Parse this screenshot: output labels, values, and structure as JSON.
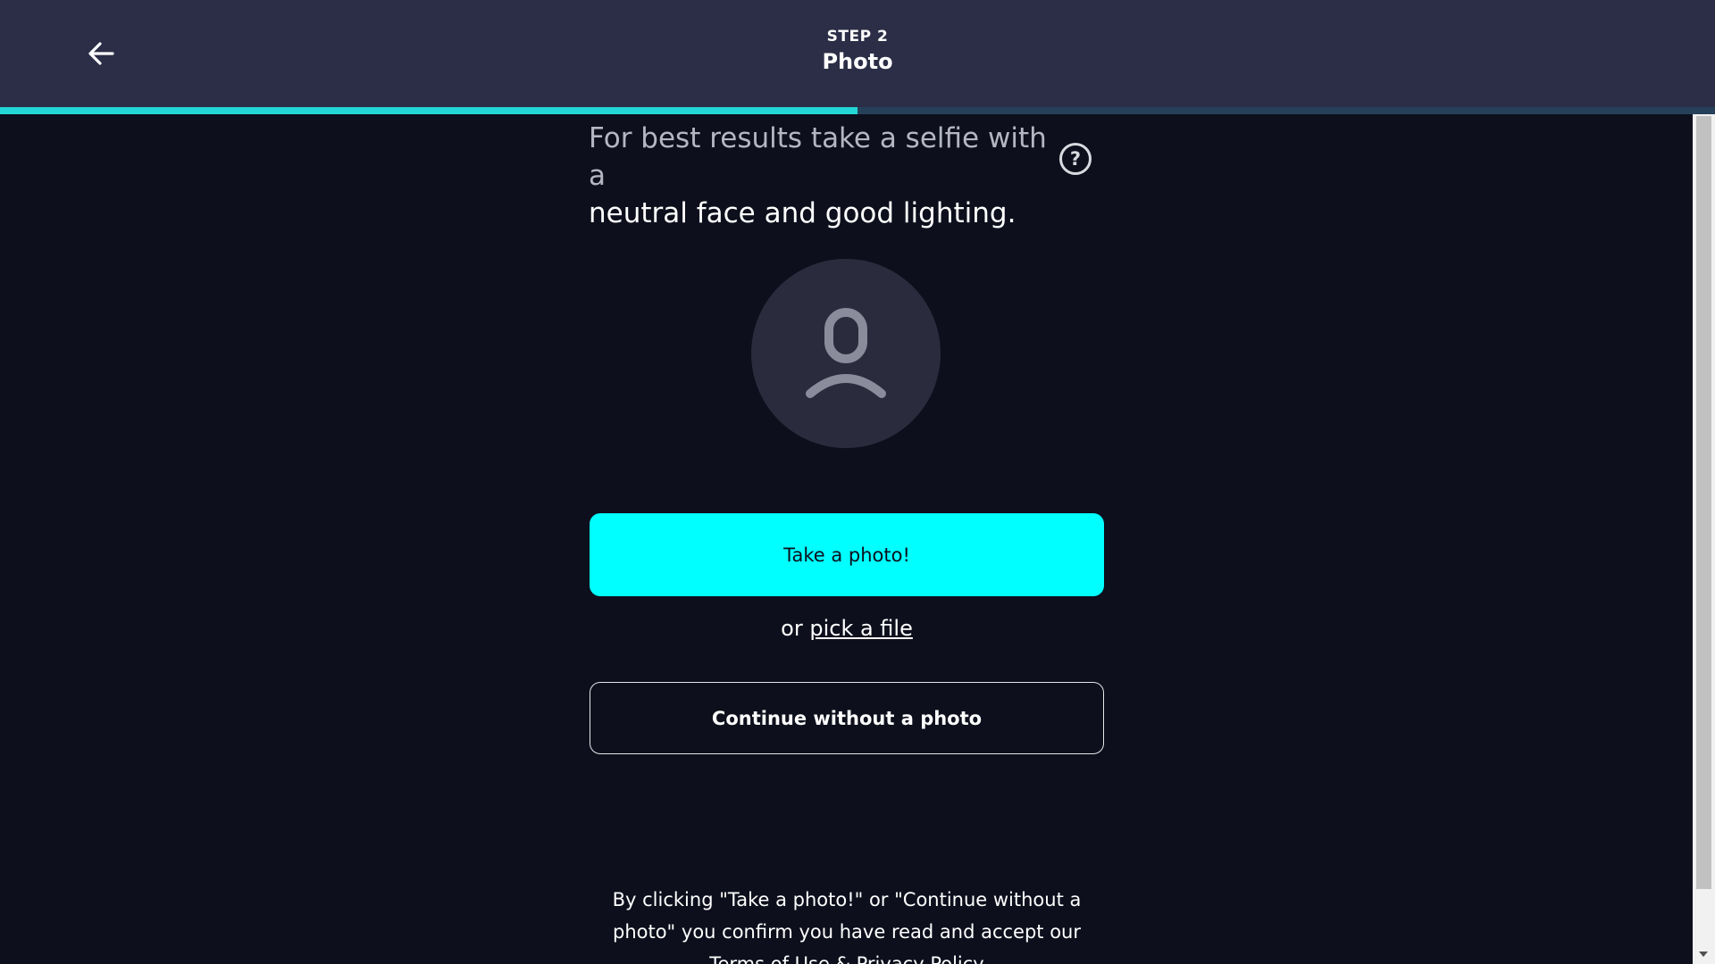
{
  "header": {
    "step_label": "STEP 2",
    "title": "Photo",
    "back_icon": "arrow-left-icon",
    "progress": 0.5
  },
  "main": {
    "instruction_muted": "For best results take a selfie with a",
    "instruction_strong": "neutral face and good lighting.",
    "help_icon": "question-circle-icon",
    "help_glyph": "?",
    "avatar_icon": "user-placeholder-icon",
    "take_photo_label": "Take a photo!",
    "pick_prefix": "or",
    "pick_link": "pick a file",
    "continue_label": "Continue without a photo"
  },
  "footer": {
    "legal_text": "By clicking \"Take a photo!\" or \"Continue without a photo\" you confirm you have read and accept our",
    "legal_link": "Terms of Use & Privacy Policy"
  },
  "colors": {
    "background": "#0d0f1c",
    "header": "#2b2e46",
    "accent": "#00ffff",
    "progress": "#23d7d7"
  }
}
